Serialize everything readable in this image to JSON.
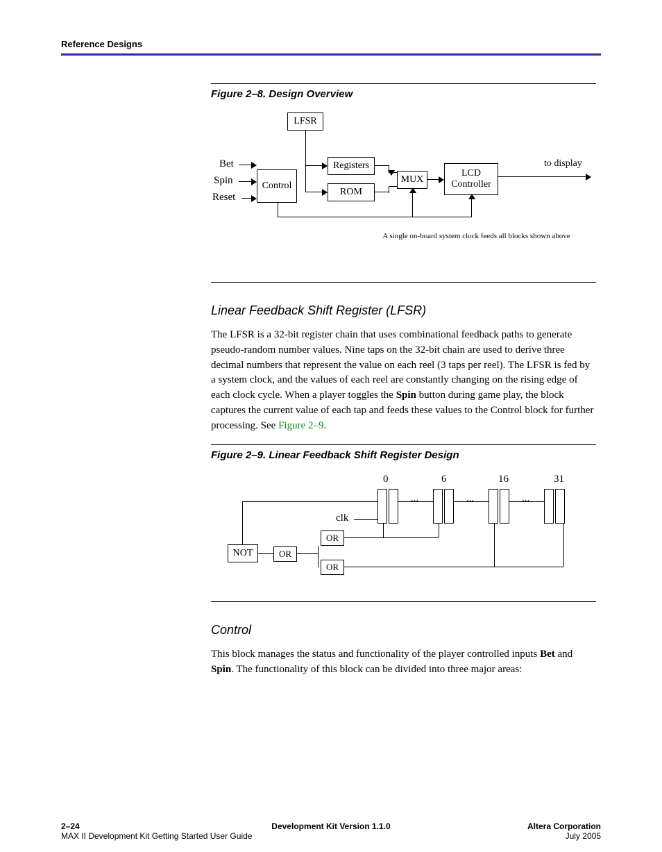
{
  "header": {
    "section": "Reference Designs"
  },
  "figure1": {
    "caption": "Figure 2–8. Design Overview",
    "labels": {
      "lfsr": "LFSR",
      "bet": "Bet",
      "spin": "Spin",
      "reset": "Reset",
      "control": "Control",
      "registers": "Registers",
      "rom": "ROM",
      "mux": "MUX",
      "lcd1": "LCD",
      "lcd2": "Controller",
      "to_display": "to display",
      "note": "A single on-board system clock feeds all blocks shown above"
    }
  },
  "section1": {
    "heading": "Linear Feedback Shift Register (LFSR)",
    "para_a": "The LFSR is a 32-bit register chain that uses combinational feedback paths to generate pseudo-random number values. Nine taps on the 32-bit chain are used to derive three decimal numbers that represent the value on each reel (3 taps per reel). The LFSR is fed by a system clock, and the values of each reel are constantly changing on the rising edge of each clock cycle. When a player toggles the ",
    "spin_word": "Spin",
    "para_b": " button during game play, the block captures the current value of each tap and feeds these values to the Control block for further processing. See ",
    "figref": "Figure 2–9",
    "para_c": "."
  },
  "figure2": {
    "caption": "Figure 2–9. Linear Feedback Shift Register Design",
    "labels": {
      "not": "NOT",
      "or_mid": "OR",
      "or_top": "OR",
      "or_bot": "OR",
      "clk": "clk",
      "n0": "0",
      "n6": "6",
      "n16": "16",
      "n31": "31",
      "dots": "..."
    }
  },
  "section2": {
    "heading": "Control",
    "para_a": "This block manages the status and functionality of the player controlled inputs ",
    "bet_word": "Bet",
    "and_word": " and ",
    "spin_word": "Spin",
    "para_b": ". The functionality of this block can be divided into three major areas:"
  },
  "footer": {
    "left_l1": "2–24",
    "left_l2": "MAX II Development Kit Getting Started User Guide",
    "center": "Development Kit Version 1.1.0",
    "right_l1": "Altera Corporation",
    "right_l2": "July 2005"
  }
}
